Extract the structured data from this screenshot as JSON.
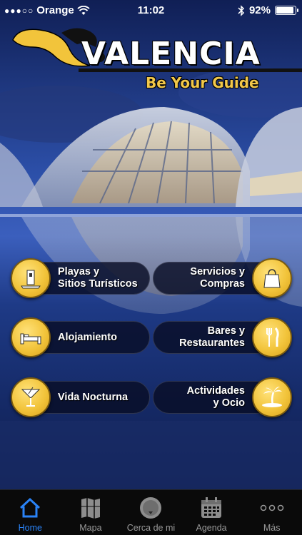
{
  "status_bar": {
    "carrier": "Orange",
    "time": "11:02",
    "battery_percent": "92%",
    "signal_bars": 3
  },
  "logo": {
    "title": "VALENCIA",
    "subtitle": "Be Your Guide"
  },
  "colors": {
    "accent_yellow": "#f2c43b",
    "tab_active_blue": "#2a83f7",
    "tab_inactive_gray": "#9a9a9a"
  },
  "menu": [
    {
      "line1": "Playas y",
      "line2": "Sitios Turísticos",
      "icon": "tower-icon"
    },
    {
      "line1": "Servicios y",
      "line2": "Compras",
      "icon": "shopping-bag-icon"
    },
    {
      "line1": "Alojamiento",
      "line2": "",
      "icon": "bed-icon"
    },
    {
      "line1": "Bares y",
      "line2": "Restaurantes",
      "icon": "fork-knife-icon"
    },
    {
      "line1": "Vida Nocturna",
      "line2": "",
      "icon": "cocktail-icon"
    },
    {
      "line1": "Actividades",
      "line2": "y Ocio",
      "icon": "palm-island-icon"
    }
  ],
  "tabs": [
    {
      "label": "Home",
      "icon": "home-icon",
      "active": true
    },
    {
      "label": "Mapa",
      "icon": "map-icon",
      "active": false
    },
    {
      "label": "Cerca de mi",
      "icon": "location-icon",
      "active": false
    },
    {
      "label": "Agenda",
      "icon": "calendar-icon",
      "active": false
    },
    {
      "label": "Más",
      "icon": "more-icon",
      "active": false
    }
  ]
}
